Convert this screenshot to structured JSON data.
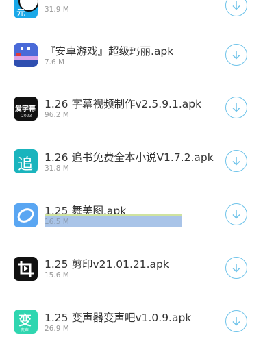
{
  "files": [
    {
      "name": "",
      "size": "31.9 M",
      "icon": "partial-app-icon"
    },
    {
      "name": "『安卓游戏』超级玛丽.apk",
      "size": "7.6 M",
      "icon": "super-mario-game-icon"
    },
    {
      "name": "1.26 字幕视频制作v2.5.9.1.apk",
      "size": "96.2 M",
      "icon": "subtitle-video-app-icon",
      "icon_text": "爱字幕",
      "icon_sub": "2023"
    },
    {
      "name": "1.26 追书免费全本小说V1.7.2.apk",
      "size": "31.8 M",
      "icon": "novel-reader-app-icon",
      "icon_text": "追"
    },
    {
      "name": "1.25 舞美图.apk",
      "size": "16.5 M",
      "icon": "photo-app-icon"
    },
    {
      "name": "1.25 剪印v21.01.21.apk",
      "size": "15.6 M",
      "icon": "crop-video-app-icon"
    },
    {
      "name": "1.25 变声器变声吧v1.0.9.apk",
      "size": "26.9 M",
      "icon": "voice-changer-app-icon",
      "icon_text": "变",
      "icon_sub": "变声"
    }
  ],
  "download_icon": "download-arrow-icon",
  "colors": {
    "accent": "#6ec3ea",
    "text": "#333333",
    "muted": "#9a9a9a",
    "selection": "#a9c4e8"
  }
}
